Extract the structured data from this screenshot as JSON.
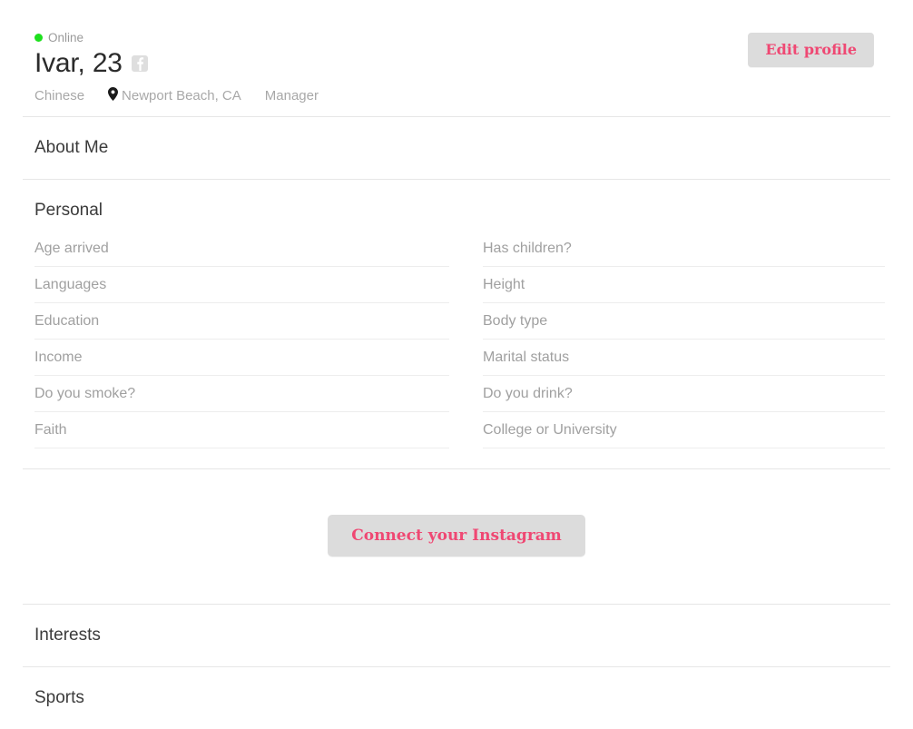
{
  "profile": {
    "status": {
      "label": "Online",
      "dot_color": "#1ee01e"
    },
    "name_age": "Ivar, 23",
    "social_badge": "facebook-icon",
    "ethnicity": "Chinese",
    "location": "Newport Beach, CA",
    "occupation": "Manager",
    "edit_button_label": "Edit profile"
  },
  "sections": {
    "about_me": "About Me",
    "personal": "Personal",
    "interests": "Interests",
    "sports": "Sports"
  },
  "personal_fields": {
    "left": [
      "Age arrived",
      "Languages",
      "Education",
      "Income",
      "Do you smoke?",
      "Faith"
    ],
    "right": [
      "Has children?",
      "Height",
      "Body type",
      "Marital status",
      "Do you drink?",
      "College or University"
    ]
  },
  "instagram": {
    "connect_label": "Connect your Instagram"
  },
  "colors": {
    "accent": "#ef4873",
    "button_bg": "#dcdcdc",
    "muted_text": "#a0a0a0",
    "heading_text": "#3b3b3b",
    "rule": "#e6e6e6",
    "online_green": "#1ee01e"
  }
}
